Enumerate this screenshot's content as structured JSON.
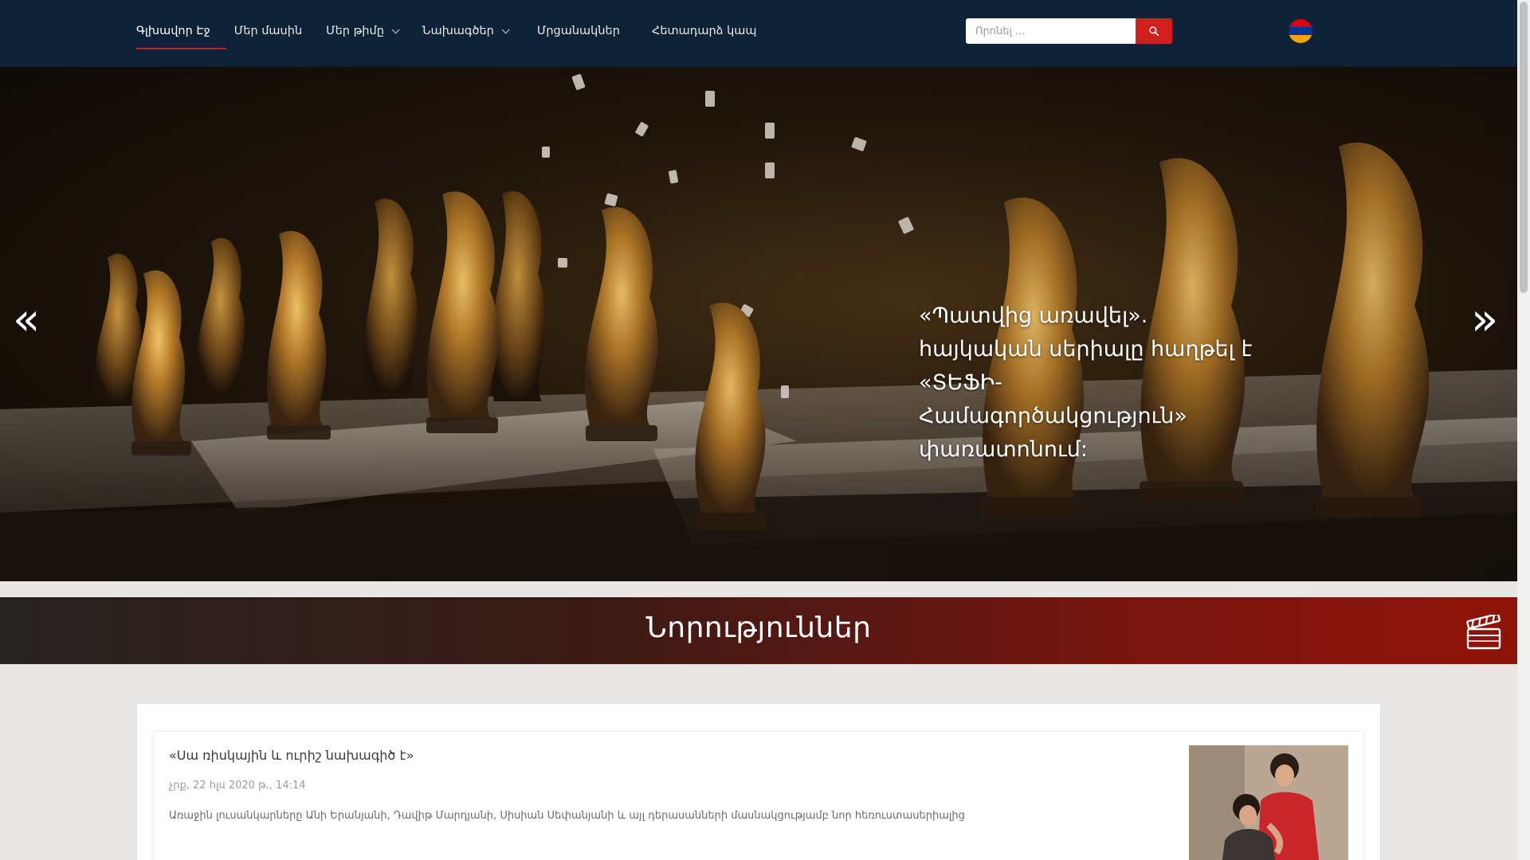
{
  "nav": {
    "items": [
      {
        "label": "Գլխավոր Էջ",
        "active": true,
        "dropdown": false
      },
      {
        "label": "Մեր մասին",
        "active": false,
        "dropdown": false
      },
      {
        "label": "Մեր թիմը",
        "active": false,
        "dropdown": true
      },
      {
        "label": "Նախագծեր",
        "active": false,
        "dropdown": true
      },
      {
        "label": "Մրցանակներ",
        "active": false,
        "dropdown": false
      },
      {
        "label": "Հետադարձ կապ",
        "active": false,
        "dropdown": false
      }
    ],
    "search": {
      "placeholder": "Որոնել ...",
      "button_icon": "search-icon"
    },
    "language_flag": {
      "icon": "armenian-flag-icon",
      "colors": [
        "#d90012",
        "#0033a0",
        "#f2a800"
      ]
    }
  },
  "hero": {
    "caption": "«Պատվից առավել». հայկական սերիալը հաղթել է «ՏԵՖԻ-Համագործակցություն» փառատոնում:",
    "prev_icon": "double-chevron-left-icon",
    "next_icon": "double-chevron-right-icon",
    "prev_glyph": "«",
    "next_glyph": "»"
  },
  "section": {
    "title": "Նորություններ",
    "icon": "clapperboard-icon"
  },
  "news": [
    {
      "title": "«Սա ռիսկային և ուրիշ նախագիծ է»",
      "date": "չրք, 22 հլս 2020 թ., 14:14",
      "excerpt": "Առաջին լուսանկարները Անի Երանյանի, Դավիթ Մարդյանի, Սիսիան Սեփանյանի և այլ դերասանների մասնակցությամբ նոր հեռուստասերիալից"
    }
  ],
  "colors": {
    "navbar_bg": "#0d2236",
    "accent_red": "#d11f1d",
    "banner_dark": "#262321",
    "banner_red": "#8f1309"
  }
}
